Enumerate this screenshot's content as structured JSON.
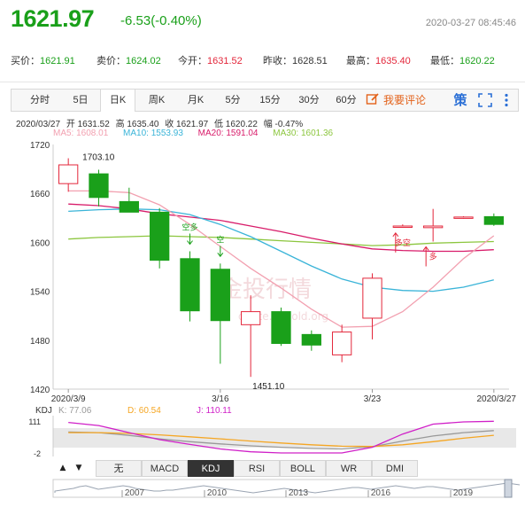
{
  "header": {
    "price": "1621.97",
    "change": "-6.53(-0.40%)",
    "timestamp": "2020-03-27 08:45:46"
  },
  "quotes": [
    {
      "label": "买价：",
      "value": "1621.91",
      "dir": "down"
    },
    {
      "label": "卖价：",
      "value": "1624.02",
      "dir": "down"
    },
    {
      "label": "今开：",
      "value": "1631.52",
      "dir": "up"
    },
    {
      "label": "昨收：",
      "value": "1628.51",
      "dir": "flat"
    },
    {
      "label": "最高：",
      "value": "1635.40",
      "dir": "up"
    },
    {
      "label": "最低：",
      "value": "1620.22",
      "dir": "down"
    }
  ],
  "tabs": [
    "分时",
    "5日",
    "日K",
    "周K",
    "月K",
    "5分",
    "15分",
    "30分",
    "60分"
  ],
  "active_tab": "日K",
  "comment_label": "我要评论",
  "icons": {
    "comment": "edit-icon",
    "policy": "ce-icon",
    "fullscreen": "expand-icon",
    "more": "more-vertical-icon"
  },
  "policy_label": "策",
  "info": {
    "date": "2020/03/27",
    "open": "开 1631.52",
    "high": "高 1635.40",
    "close": "收 1621.97",
    "low": "低 1620.22",
    "amp": "幅 -0.47%"
  },
  "ma_labels": {
    "ma5": "MA5: 1608.01",
    "ma10": "MA10: 1553.93",
    "ma20": "MA20: 1591.04",
    "ma30": "MA30: 1601.36"
  },
  "kdj_labels": {
    "name": "KDJ",
    "k": "K: 77.06",
    "d": "D: 60.54",
    "j": "J: 110.11"
  },
  "indicator_tabs": [
    "无",
    "MACD",
    "KDJ",
    "RSI",
    "BOLL",
    "WR",
    "DMI"
  ],
  "active_indicator": "KDJ",
  "arrow_labels": {
    "up": "▲",
    "down": "▼"
  },
  "colors": {
    "up": "#e3263a",
    "down": "#1aa01a",
    "ma5": "#f2a0b0",
    "ma10": "#3ab4d8",
    "ma20": "#d81c6a",
    "ma30": "#8cc63e",
    "k": "#999999",
    "d": "#f5a623",
    "j": "#d020c8"
  },
  "watermark": "金投行情 quote.cngold.org",
  "chart_data": {
    "type": "candlestick",
    "ylim": [
      1420,
      1720
    ],
    "y_ticks": [
      1720,
      1660,
      1600,
      1540,
      1480,
      1420
    ],
    "x_tick_labels": [
      {
        "index": 0,
        "label": "2020/3/9"
      },
      {
        "index": 5,
        "label": "3/16"
      },
      {
        "index": 10,
        "label": "3/23"
      },
      {
        "index": 14,
        "label": "2020/3/27"
      }
    ],
    "dates": [
      "3/9",
      "3/10",
      "3/11",
      "3/12",
      "3/13",
      "3/16",
      "3/17",
      "3/18",
      "3/19",
      "3/20",
      "3/23",
      "3/24",
      "3/25",
      "3/26",
      "3/27"
    ],
    "candles": [
      {
        "open": 1672,
        "high": 1703.1,
        "low": 1662,
        "close": 1695
      },
      {
        "open": 1684,
        "high": 1689,
        "low": 1644,
        "close": 1655
      },
      {
        "open": 1650,
        "high": 1667,
        "low": 1637,
        "close": 1637
      },
      {
        "open": 1637,
        "high": 1642,
        "low": 1568,
        "close": 1578
      },
      {
        "open": 1580,
        "high": 1589,
        "low": 1503,
        "close": 1516
      },
      {
        "open": 1567,
        "high": 1574,
        "low": 1451.1,
        "close": 1504
      },
      {
        "open": 1499,
        "high": 1535,
        "low": 1435,
        "close": 1515
      },
      {
        "open": 1515,
        "high": 1520,
        "low": 1473,
        "close": 1476
      },
      {
        "open": 1487,
        "high": 1492,
        "low": 1467,
        "close": 1474
      },
      {
        "open": 1462,
        "high": 1499,
        "low": 1453,
        "close": 1490
      },
      {
        "open": 1507,
        "high": 1562,
        "low": 1481,
        "close": 1556
      },
      {
        "open": 1620,
        "high": 1622,
        "low": 1618,
        "close": 1620
      },
      {
        "open": 1618,
        "high": 1641,
        "low": 1601,
        "close": 1620
      },
      {
        "open": 1630,
        "high": 1632,
        "low": 1629,
        "close": 1631
      },
      {
        "open": 1631.52,
        "high": 1635.4,
        "low": 1620.22,
        "close": 1621.97
      }
    ],
    "high_label": "1703.10",
    "low_label": "1451.10",
    "ma5": [
      1663,
      1663,
      1661,
      1646,
      1622,
      1595,
      1568,
      1544,
      1518,
      1496,
      1497,
      1515,
      1545,
      1580,
      1608
    ],
    "ma10": [
      1638,
      1640,
      1641,
      1640,
      1634,
      1622,
      1607,
      1589,
      1571,
      1555,
      1545,
      1541,
      1540,
      1545,
      1554
    ],
    "ma20": [
      1647,
      1645,
      1641,
      1635,
      1631,
      1627,
      1620,
      1613,
      1605,
      1598,
      1592,
      1590,
      1589,
      1589,
      1591
    ],
    "ma30": [
      1604,
      1606,
      1607,
      1608,
      1607,
      1606,
      1604,
      1602,
      1600,
      1598,
      1596,
      1597,
      1599,
      1600,
      1601
    ],
    "annotations": [
      {
        "index": 4,
        "text": "空多",
        "dir": "down"
      },
      {
        "index": 5,
        "text": "空",
        "dir": "down"
      },
      {
        "index": 11,
        "text": "多空",
        "dir": "up"
      },
      {
        "index": 12,
        "text": "多",
        "dir": "up"
      }
    ],
    "kdj": {
      "ylim": [
        -2,
        111
      ],
      "y_ticks": [
        111,
        -2
      ],
      "k": [
        72,
        70,
        60,
        48,
        38,
        30,
        23,
        18,
        14,
        12,
        20,
        40,
        58,
        70,
        77.06
      ],
      "d": [
        70,
        70,
        67,
        62,
        55,
        48,
        40,
        33,
        27,
        22,
        21,
        27,
        38,
        50,
        60.54
      ],
      "j": [
        106,
        95,
        70,
        45,
        28,
        12,
        2,
        -2,
        -2,
        -2,
        18,
        65,
        100,
        108,
        110.11
      ]
    },
    "navigator": {
      "x_labels": [
        "2007",
        "2010",
        "2013",
        "2016",
        "2019"
      ]
    }
  }
}
